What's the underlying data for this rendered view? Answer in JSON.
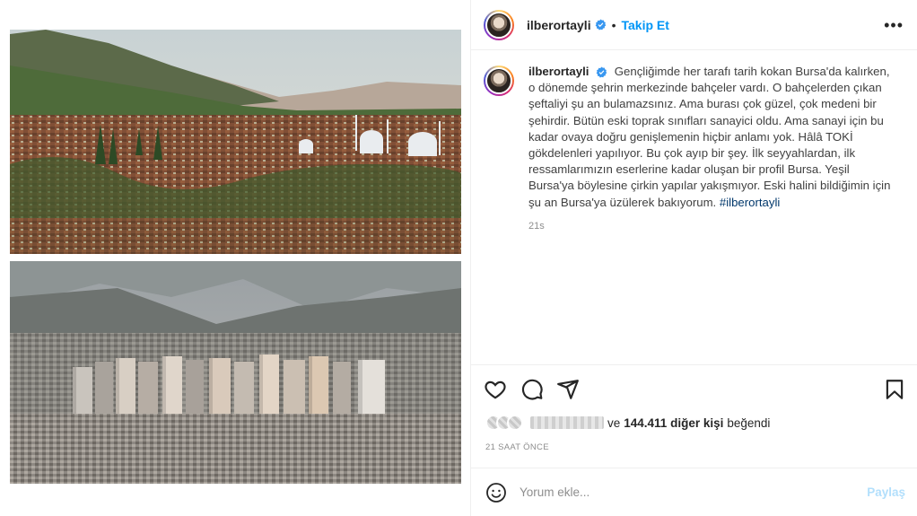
{
  "post": {
    "username": "ilberortayli",
    "follow_label": "Takip Et",
    "separator": "•",
    "more_label": "•••"
  },
  "caption": {
    "username": "ilberortayli",
    "text": "Gençliğimde her tarafı tarih kokan Bursa'da kalırken, o dönemde şehrin merkezinde bahçeler vardı. O bahçelerden çıkan şeftaliyi şu an bulamazsınız. Ama burası çok güzel, çok medeni bir şehirdir. Bütün eski toprak sınıfları sanayici oldu. Ama sanayi için bu kadar ovaya doğru genişlemenin hiçbir anlamı yok. Hâlâ TOKİ gökdelenleri yapılıyor. Bu çok ayıp bir şey. İlk seyyahlardan, ilk ressamlarımızın eserlerine kadar oluşan bir profil Bursa. Yeşil Bursa'ya böylesine çirkin yapılar yakışmıyor. Eski halini bildiğimin için şu an Bursa'ya üzülerek bakıyorum. ",
    "hashtag": "#ilberortayli",
    "time_ago": "21s"
  },
  "icons": {
    "like": "heart-icon",
    "comment": "comment-icon",
    "share": "send-icon",
    "save": "bookmark-icon",
    "emoji": "emoji-icon",
    "verified": "verified-badge-icon"
  },
  "likes": {
    "prefix": "ve",
    "count": "144.411 diğer kişi",
    "suffix": "beğendi"
  },
  "date": "21 SAAT ÖNCE",
  "comment": {
    "placeholder": "Yorum ekle...",
    "submit_label": "Paylaş"
  },
  "colors": {
    "accent": "#0095f6",
    "verified": "#3897f0",
    "submit_disabled": "#b2dffc",
    "hashtag": "#00376b",
    "muted": "#8e8e8e"
  }
}
